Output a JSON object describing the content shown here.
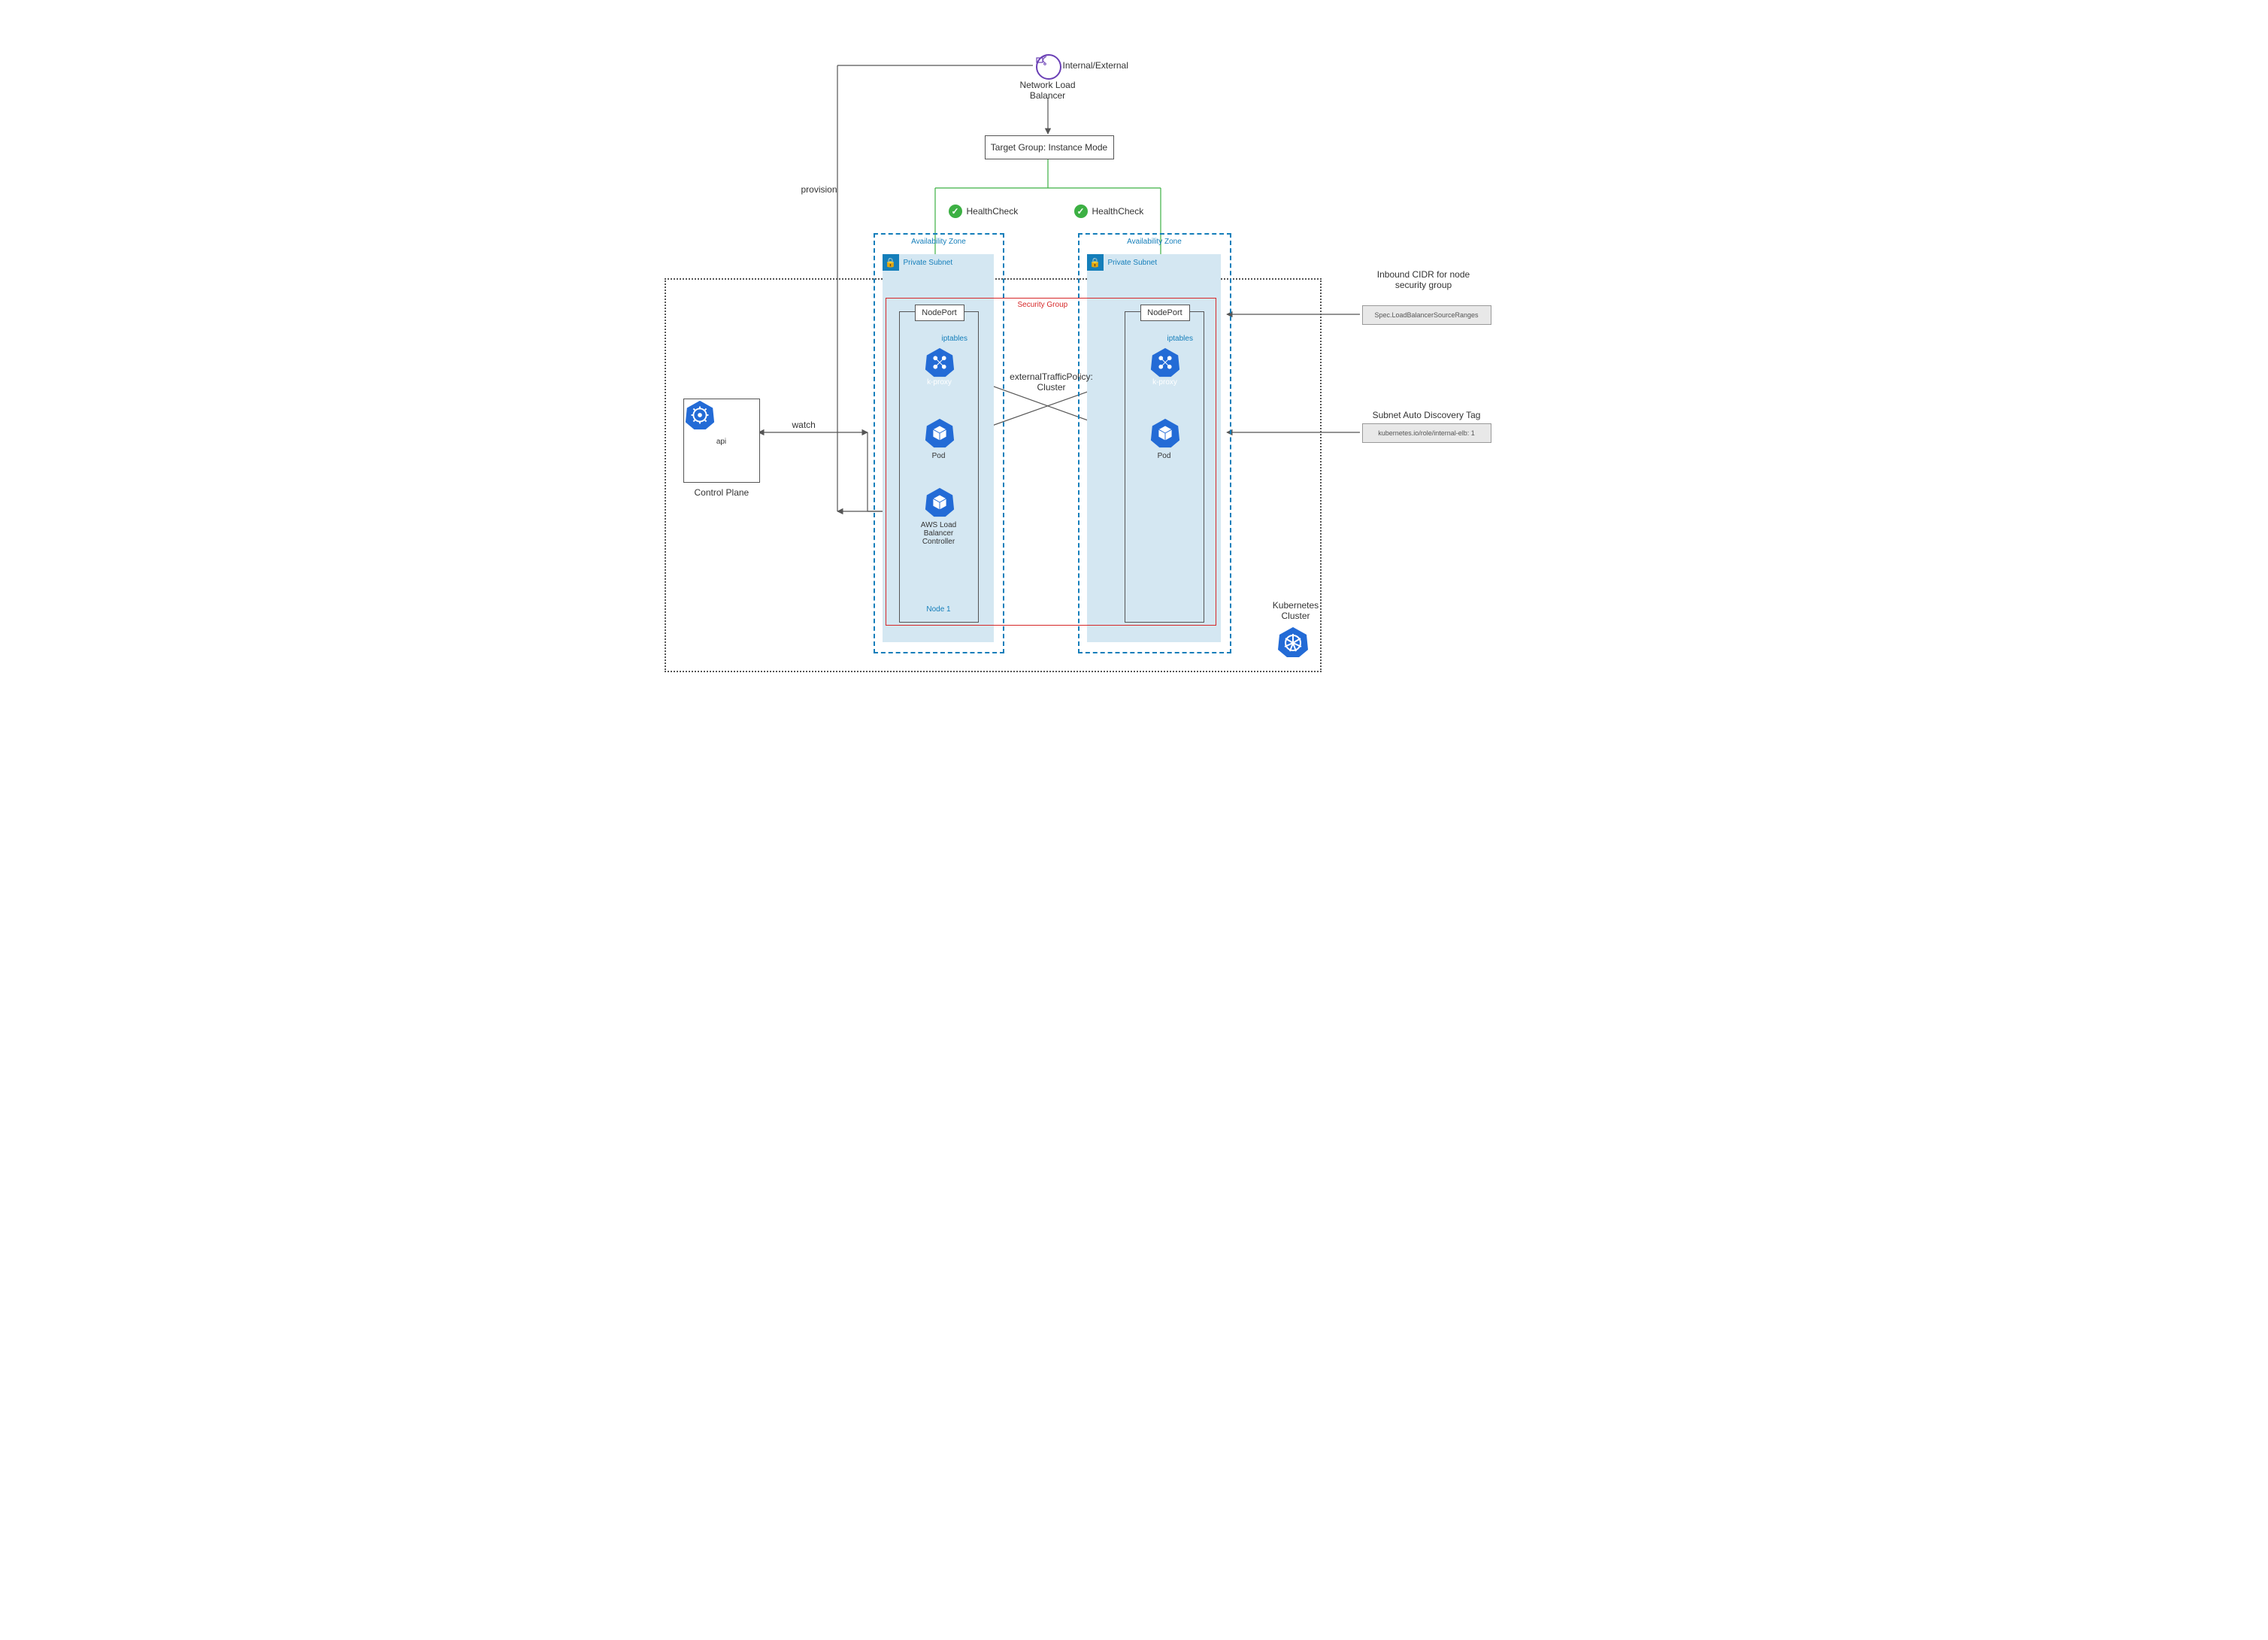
{
  "nlb": {
    "label1": "Network Load",
    "label2": "Balancer",
    "side": "Internal/External"
  },
  "target_group": "Target Group: Instance Mode",
  "provision": "provision",
  "healthcheck": "HealthCheck",
  "az_title": "Availability Zone",
  "private_subnet": "Private Subnet",
  "nodeport": "NodePort",
  "iptables": "iptables",
  "kproxy": "k-proxy",
  "pod": "Pod",
  "aws_lbc": {
    "l1": "AWS Load",
    "l2": "Balancer",
    "l3": "Controller"
  },
  "node1": "Node 1",
  "external_traffic": {
    "l1": "externalTrafficPolicy:",
    "l2": "Cluster"
  },
  "security_group": "Security Group",
  "control_plane": {
    "title": "Control Plane",
    "api": "api"
  },
  "watch": "watch",
  "k8s_cluster": {
    "l1": "Kubernetes",
    "l2": "Cluster"
  },
  "inbound": {
    "title1": "Inbound CIDR for node",
    "title2": "security group",
    "code": "Spec.LoadBalancerSourceRanges"
  },
  "subnet_tag": {
    "title": "Subnet Auto Discovery Tag",
    "code": "kubernetes.io/role/internal-elb: 1"
  }
}
